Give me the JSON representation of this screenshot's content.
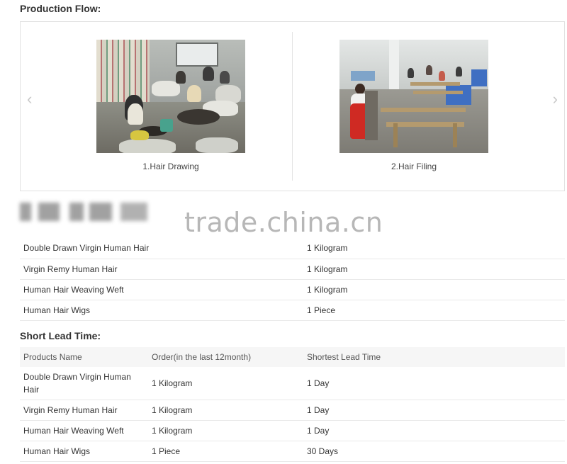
{
  "production_flow": {
    "title": "Production Flow:",
    "prev_arrow": "‹",
    "next_arrow": "›",
    "slides": [
      {
        "caption": "1.Hair Drawing"
      },
      {
        "caption": "2.Hair Filing"
      }
    ]
  },
  "watermark": "trade.china.cn",
  "moq_table": {
    "rows": [
      {
        "product": "Double Drawn Virgin Human Hair",
        "quantity": "1 Kilogram"
      },
      {
        "product": "Virgin Remy Human Hair",
        "quantity": "1 Kilogram"
      },
      {
        "product": "Human Hair Weaving Weft",
        "quantity": "1 Kilogram"
      },
      {
        "product": "Human Hair Wigs",
        "quantity": "1 Piece"
      }
    ]
  },
  "lead_time": {
    "title": "Short Lead Time:",
    "headers": [
      "Products Name",
      "Order(in the last 12month)",
      "Shortest Lead Time"
    ],
    "rows": [
      {
        "product": "Double Drawn Virgin Human Hair",
        "order": "1 Kilogram",
        "lead": "1 Day"
      },
      {
        "product": "Virgin Remy Human Hair",
        "order": "1 Kilogram",
        "lead": "1 Day"
      },
      {
        "product": "Human Hair Weaving Weft",
        "order": "1 Kilogram",
        "lead": "1 Day"
      },
      {
        "product": "Human Hair Wigs",
        "order": "1 Piece",
        "lead": "30 Days"
      }
    ]
  },
  "colors": {
    "border": "#e1e1e1",
    "header_bg": "#f6f6f6",
    "apron_red": "#cf2a23",
    "crate_blue": "#3f6fc2"
  }
}
